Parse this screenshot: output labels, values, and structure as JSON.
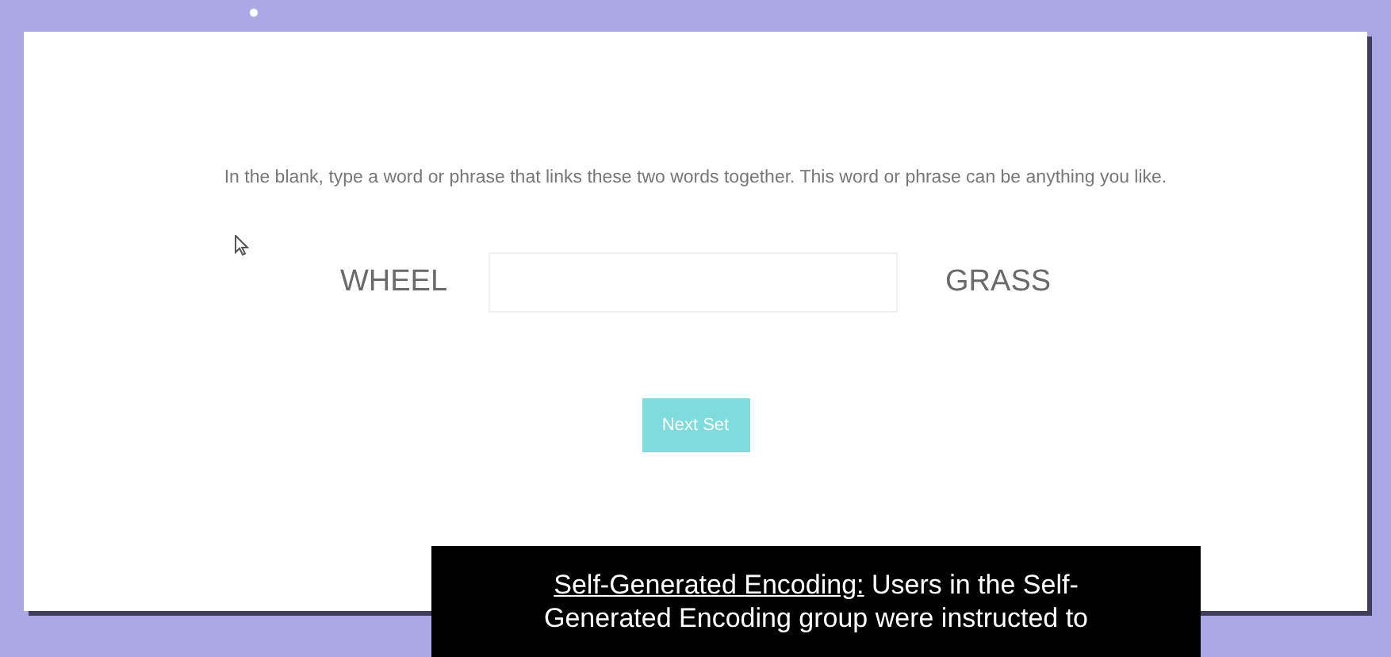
{
  "instructions": "In the blank, type a word or phrase that links these two words together. This word or phrase can be anything you like.",
  "word_pair": {
    "left_word": "WHEEL",
    "right_word": "GRASS"
  },
  "button": {
    "label": "Next Set"
  },
  "caption": {
    "term": "Self-Generated Encoding:",
    "text": "Users in the Self-Generated Encoding group were instructed to"
  }
}
